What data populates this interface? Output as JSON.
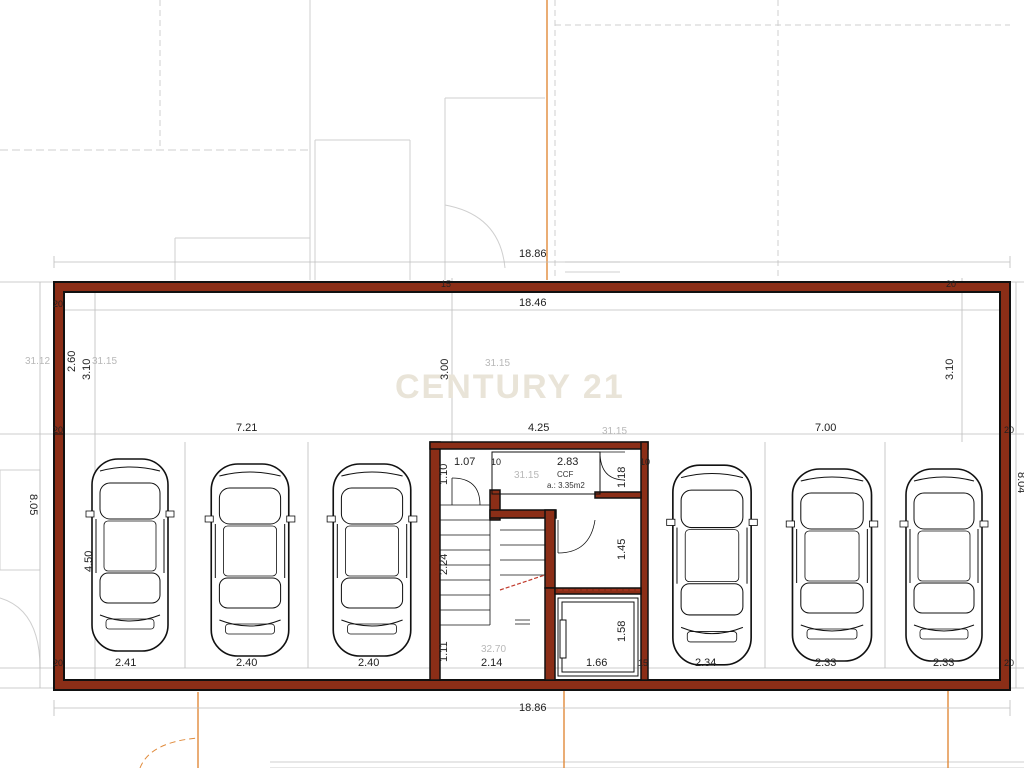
{
  "watermark": "CENTURY 21",
  "colors": {
    "wall_fill": "#8b2e17",
    "wall_stroke": "#111111",
    "neighbor_line": "#e08a3a",
    "grid_line": "#bdbdbd"
  },
  "dimensions": {
    "top_outer": "18.86",
    "top_inner": "18.46",
    "bottom_outer": "18.86",
    "aisle_left": "3.10",
    "aisle_left_small": "2.60",
    "aisle_center": "3.00",
    "aisle_right": "3.10",
    "bay_left_width": "7.21",
    "core_width": "4.25",
    "bay_right_width": "7.00",
    "parking_depth": "4.50",
    "left_side": "8.05",
    "right_side": "8.04",
    "wall_thickness": "20",
    "wall_thickness_2": "15",
    "stair_landing": "1.07",
    "stair_small": "10",
    "ccf_width": "2.83",
    "ccf_depth": "1.18",
    "core_left_height": "1.10",
    "stair_run": "2.24",
    "core_bottom_left": "1.11",
    "corridor": "1.45",
    "lift_depth": "1.58",
    "core_bottom_width": "2.14",
    "lift_width": "1.66",
    "bay_left": [
      "2.41",
      "2.40",
      "2.40"
    ],
    "bay_right": [
      "2.34",
      "2.33",
      "2.33"
    ]
  },
  "levels": {
    "left_a": "31.12",
    "left_b": "31.15",
    "aisle": "31.15",
    "core": "31.15",
    "ccf": "31.15",
    "stair": "32.70"
  },
  "room_label": "CCF",
  "room_area": "a.: 3.35m2"
}
